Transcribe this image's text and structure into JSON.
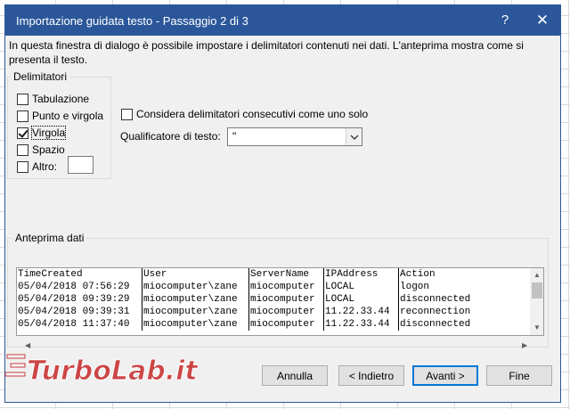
{
  "window": {
    "title": "Importazione guidata testo - Passaggio 2 di 3",
    "help_label": "?",
    "close_label": "✕"
  },
  "intro_text": "In questa finestra di dialogo è possibile impostare i delimitatori contenuti nei dati. L'anteprima mostra come si presenta il testo.",
  "delimiters": {
    "group_label": "Delimitatori",
    "items": [
      {
        "label": "Tabulazione",
        "checked": false
      },
      {
        "label": "Punto e virgola",
        "checked": false
      },
      {
        "label": "Virgola",
        "checked": true
      },
      {
        "label": "Spazio",
        "checked": false
      },
      {
        "label": "Altro:",
        "checked": false
      }
    ],
    "altro_value": ""
  },
  "consecutive": {
    "label": "Considera delimitatori consecutivi come uno solo",
    "checked": false
  },
  "qualifier": {
    "label": "Qualificatore di testo:",
    "value": "\""
  },
  "preview": {
    "group_label": "Anteprima dati",
    "rows": [
      [
        "TimeCreated",
        "User",
        "ServerName",
        "IPAddress",
        "Action"
      ],
      [
        "05/04/2018 07:56:29",
        "miocomputer\\zane",
        "miocomputer",
        "LOCAL",
        "logon"
      ],
      [
        "05/04/2018 09:39:29",
        "miocomputer\\zane",
        "miocomputer",
        "LOCAL",
        "disconnected"
      ],
      [
        "05/04/2018 09:39:31",
        "miocomputer\\zane",
        "miocomputer",
        "11.22.33.44",
        "reconnection"
      ],
      [
        "05/04/2018 11:37:40",
        "miocomputer\\zane",
        "miocomputer",
        "11.22.33.44",
        "disconnected"
      ]
    ]
  },
  "buttons": {
    "annulla": "Annulla",
    "indietro": "< Indietro",
    "avanti": "Avanti >",
    "fine": "Fine"
  },
  "watermark": {
    "text": "TurboLab.it"
  },
  "colors": {
    "titlebar": "#2b579a",
    "accent": "#0078d7",
    "watermark": "#c62828"
  }
}
